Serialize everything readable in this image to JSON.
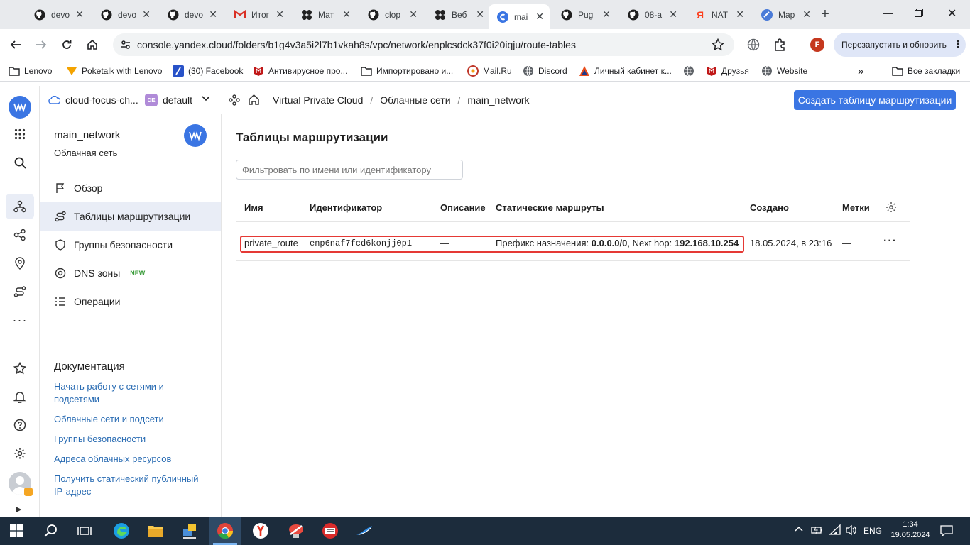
{
  "browser": {
    "tabs": [
      {
        "title": "devo",
        "icon": "github-icon"
      },
      {
        "title": "devo",
        "icon": "github-icon"
      },
      {
        "title": "devo",
        "icon": "github-icon"
      },
      {
        "title": "Итог",
        "icon": "gmail-icon"
      },
      {
        "title": "Мат",
        "icon": "app-icon"
      },
      {
        "title": "clop",
        "icon": "github-icon"
      },
      {
        "title": "Веб",
        "icon": "app-icon"
      },
      {
        "title": "mai",
        "icon": "yandex-cloud-icon",
        "active": true
      },
      {
        "title": "Pug",
        "icon": "github-icon"
      },
      {
        "title": "08-a",
        "icon": "github-icon"
      },
      {
        "title": "NAT",
        "icon": "yandex-icon"
      },
      {
        "title": "Map",
        "icon": "app-icon"
      }
    ],
    "url": "console.yandex.cloud/folders/b1g4v3a5i2l7b1vkah8s/vpc/network/enplcsdck37f0i20iqju/route-tables",
    "restart_label": "Перезапустить и обновить",
    "profile_letter": "F",
    "bookmarks": [
      {
        "label": "Lenovo",
        "icon": "folder-icon"
      },
      {
        "label": "Poketalk with Lenovo",
        "icon": "poketalk-icon"
      },
      {
        "label": "(30) Facebook",
        "icon": "facebook-icon"
      },
      {
        "label": "Антивирусное про...",
        "icon": "mcafee-icon"
      },
      {
        "label": "Импортировано и...",
        "icon": "folder-icon"
      },
      {
        "label": "Mail.Ru",
        "icon": "mailru-icon"
      },
      {
        "label": "Discord",
        "icon": "globe-icon"
      },
      {
        "label": "Личный кабинет к...",
        "icon": "cabinet-icon"
      },
      {
        "label": "",
        "icon": "globe-icon"
      },
      {
        "label": "Друзья",
        "icon": "mcafee-icon"
      },
      {
        "label": "Website",
        "icon": "globe-icon"
      }
    ],
    "all_bookmarks": "Все закладки"
  },
  "appbar": {
    "cloud_name": "cloud-focus-ch...",
    "folder_badge": "DE",
    "folder_name": "default",
    "breadcrumbs": [
      "Virtual Private Cloud",
      "Облачные сети",
      "main_network"
    ],
    "create_button": "Создать таблицу маршрутизации"
  },
  "sidebar": {
    "title": "main_network",
    "subtitle": "Облачная сеть",
    "items": [
      {
        "label": "Обзор",
        "icon": "flag-icon"
      },
      {
        "label": "Таблицы маршрутизации",
        "icon": "routes-icon",
        "selected": true
      },
      {
        "label": "Группы безопасности",
        "icon": "shield-icon"
      },
      {
        "label": "DNS зоны",
        "icon": "dns-icon",
        "badge": "NEW"
      },
      {
        "label": "Операции",
        "icon": "list-icon"
      }
    ],
    "docs_title": "Документация",
    "docs": [
      "Начать работу с сетями и подсетями",
      "Облачные сети и подсети",
      "Группы безопасности",
      "Адреса облачных ресурсов",
      "Получить статический публичный IP-адрес"
    ]
  },
  "main": {
    "title": "Таблицы маршрутизации",
    "filter_placeholder": "Фильтровать по имени или идентификатору",
    "columns": [
      "Имя",
      "Идентификатор",
      "Описание",
      "Статические маршруты",
      "Создано",
      "Метки"
    ],
    "rows": [
      {
        "name": "private_route",
        "id": "enp6naf7fcd6konjj0p1",
        "description": "—",
        "route_prefix_label": "Префикс назначения: ",
        "route_prefix": "0.0.0.0/0",
        "route_hop_label": ", Next hop: ",
        "route_hop": "192.168.10.254",
        "created": "18.05.2024, в 23:16",
        "labels": "—"
      }
    ],
    "highlight_color": "#e53935"
  },
  "taskbar": {
    "lang": "ENG",
    "time": "1:34",
    "date": "19.05.2024"
  },
  "colors": {
    "accent": "#3a75e3",
    "link": "#2a6cb3",
    "selected_bg": "#e9edf6",
    "new_badge": "#3a9c3a"
  }
}
